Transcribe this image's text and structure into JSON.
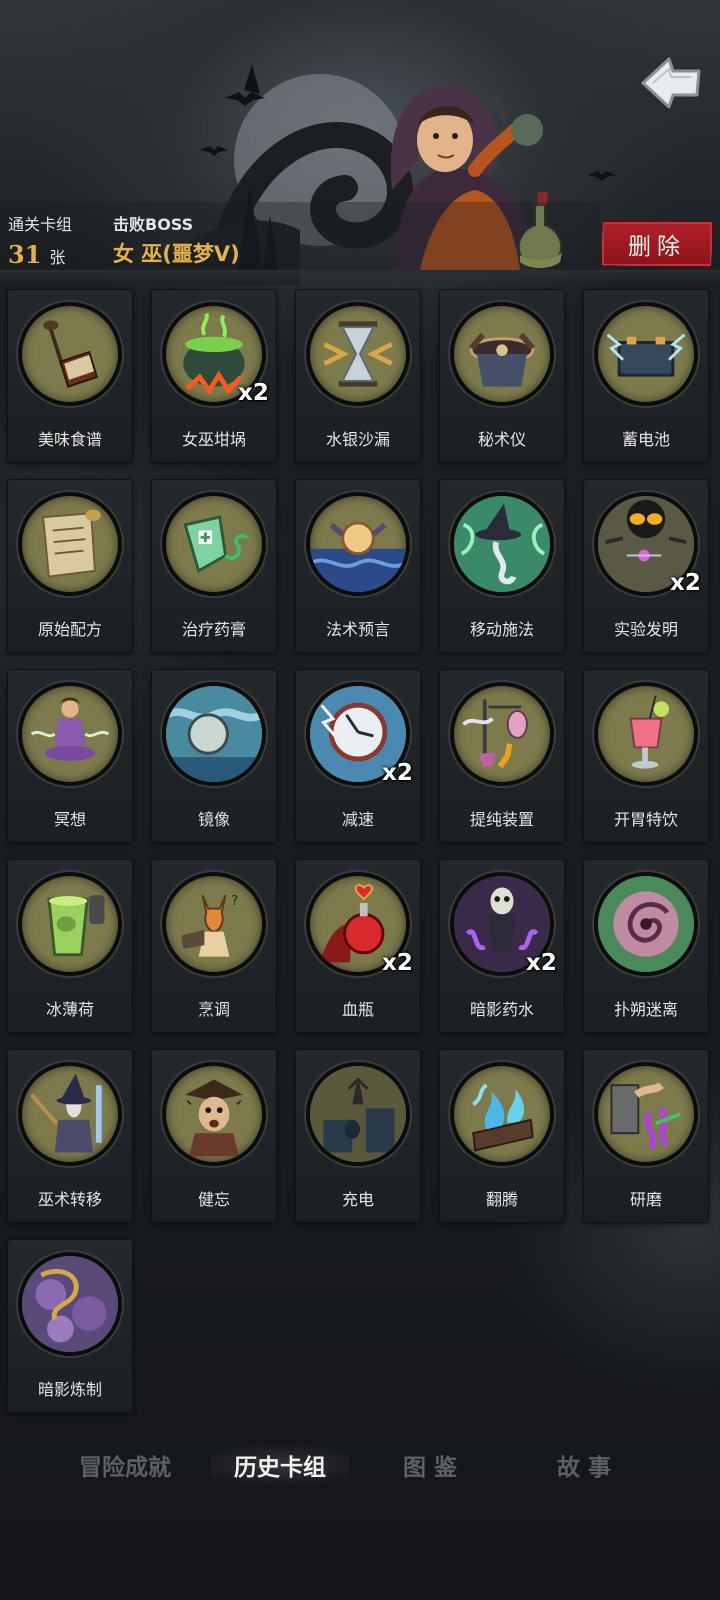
{
  "header": {
    "deck_label": "通关卡组",
    "deck_count": "31",
    "deck_unit": "张",
    "boss_label": "击败BOSS",
    "boss_name": "女 巫(噩梦V)",
    "delete_label": "删除"
  },
  "cards": [
    {
      "name": "美味食谱",
      "count": "",
      "icon": "cookbook-icon"
    },
    {
      "name": "女巫坩埚",
      "count": "x2",
      "icon": "cauldron-icon"
    },
    {
      "name": "水银沙漏",
      "count": "",
      "icon": "hourglass-icon"
    },
    {
      "name": "秘术仪",
      "count": "",
      "icon": "arcane-device-icon"
    },
    {
      "name": "蓄电池",
      "count": "",
      "icon": "battery-icon"
    },
    {
      "name": "原始配方",
      "count": "",
      "icon": "scroll-icon"
    },
    {
      "name": "治疗药膏",
      "count": "",
      "icon": "ointment-tube-icon"
    },
    {
      "name": "法术预言",
      "count": "",
      "icon": "crystal-ball-icon"
    },
    {
      "name": "移动施法",
      "count": "",
      "icon": "witch-hat-icon"
    },
    {
      "name": "实验发明",
      "count": "x2",
      "icon": "goggles-icon"
    },
    {
      "name": "冥想",
      "count": "",
      "icon": "meditation-icon"
    },
    {
      "name": "镜像",
      "count": "",
      "icon": "mirror-orb-icon"
    },
    {
      "name": "减速",
      "count": "x2",
      "icon": "clock-icon"
    },
    {
      "name": "提纯装置",
      "count": "",
      "icon": "distiller-icon"
    },
    {
      "name": "开胃特饮",
      "count": "",
      "icon": "cocktail-icon"
    },
    {
      "name": "冰薄荷",
      "count": "",
      "icon": "mint-drink-icon"
    },
    {
      "name": "烹调",
      "count": "",
      "icon": "fox-chef-icon"
    },
    {
      "name": "血瓶",
      "count": "x2",
      "icon": "blood-potion-icon"
    },
    {
      "name": "暗影药水",
      "count": "x2",
      "icon": "skeleton-icon"
    },
    {
      "name": "扑朔迷离",
      "count": "",
      "icon": "vortex-icon"
    },
    {
      "name": "巫术转移",
      "count": "",
      "icon": "wizard-icon"
    },
    {
      "name": "健忘",
      "count": "",
      "icon": "dizzy-pirate-icon"
    },
    {
      "name": "充电",
      "count": "",
      "icon": "castle-icon"
    },
    {
      "name": "翻腾",
      "count": "",
      "icon": "blue-flame-icon"
    },
    {
      "name": "研磨",
      "count": "",
      "icon": "grinder-icon"
    },
    {
      "name": "暗影炼制",
      "count": "",
      "icon": "shadow-serpent-icon"
    }
  ],
  "tabs": [
    {
      "label": "冒险成就",
      "active": false
    },
    {
      "label": "历史卡组",
      "active": true
    },
    {
      "label": "图 鉴",
      "active": false
    },
    {
      "label": "故 事",
      "active": false
    }
  ],
  "colors": {
    "accent_gold": "#e5b24a",
    "delete_red": "#a01a22",
    "art_bg": "#7d7a4c"
  }
}
